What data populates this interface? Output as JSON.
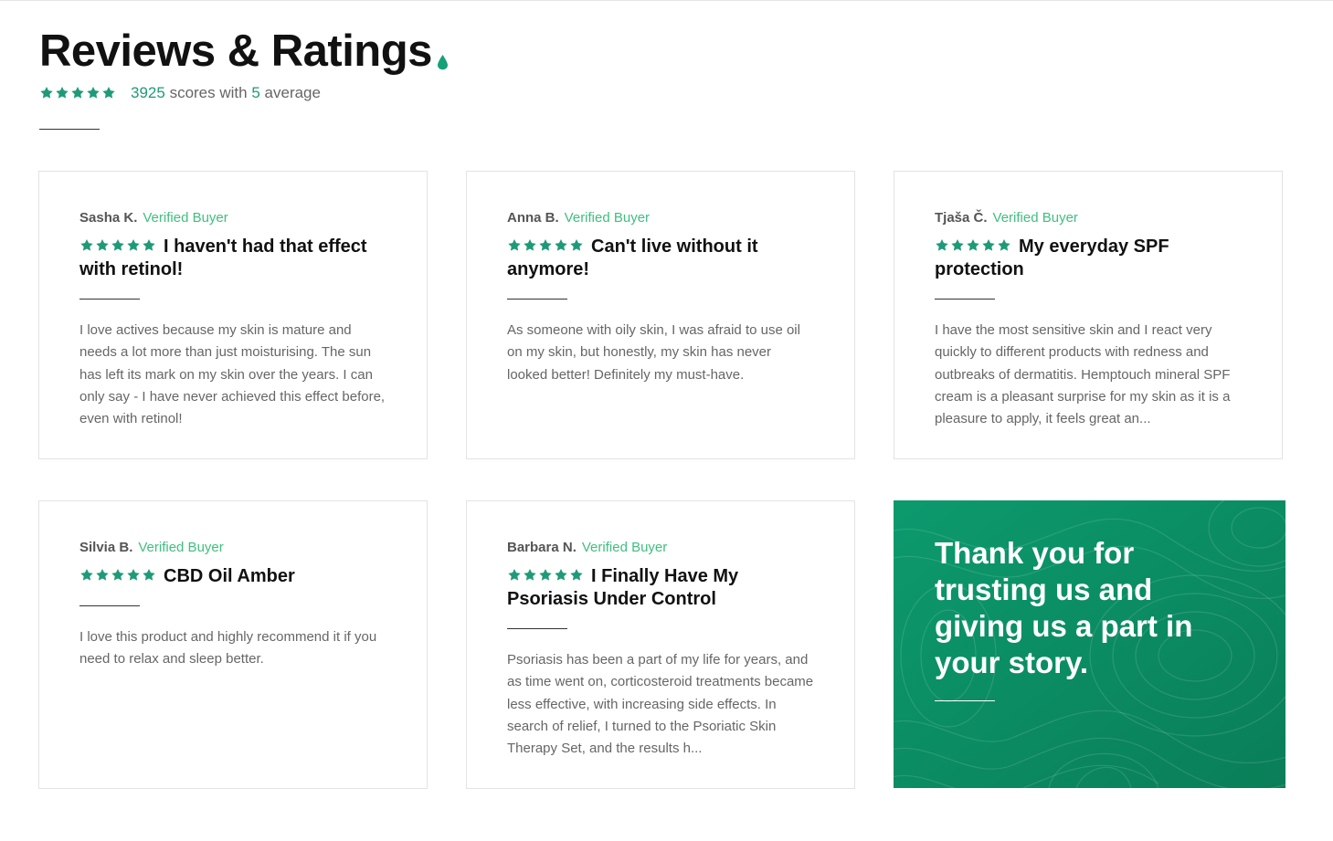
{
  "colors": {
    "accent": "#1f9a78",
    "verified": "#3fbf7f",
    "banner": "#0b8a62"
  },
  "header": {
    "title": "Reviews & Ratings",
    "rating": 5,
    "score_count": "3925",
    "scores_text": "scores with",
    "average_value": "5",
    "average_text": "average"
  },
  "reviews": [
    {
      "author": "Sasha K.",
      "badge": "Verified Buyer",
      "rating": 5,
      "headline": "I haven't had that effect with retinol!",
      "body": "I love actives because my skin is mature and needs a lot more than just moisturising. The sun has left its mark on my skin over the years. I can only say - I have never achieved this effect before, even with retinol!"
    },
    {
      "author": "Anna B.",
      "badge": "Verified Buyer",
      "rating": 5,
      "headline": "Can't live without it anymore!",
      "body": "As someone with oily skin, I was afraid to use oil on my skin, but honestly, my skin has never looked better! Definitely my must-have."
    },
    {
      "author": "Tjaša Č.",
      "badge": "Verified Buyer",
      "rating": 5,
      "headline": "My everyday SPF protection",
      "body": "I have the most sensitive skin and I react very quickly to different products with redness and outbreaks of dermatitis. Hemptouch mineral SPF cream is a pleasant surprise for my skin as it is a pleasure to apply, it feels great an..."
    },
    {
      "author": "Silvia B.",
      "badge": "Verified Buyer",
      "rating": 5,
      "headline": "CBD Oil Amber",
      "body": "I love this product and highly recommend it if you need to relax and sleep better."
    },
    {
      "author": "Barbara N.",
      "badge": "Verified Buyer",
      "rating": 5,
      "headline": "I Finally Have My Psoriasis Under Control",
      "body": "Psoriasis has been a part of my life for years, and as time went on, corticosteroid treatments became less effective, with increasing side effects. In search of relief, I turned to the Psoriatic Skin Therapy Set, and the results h..."
    }
  ],
  "banner": {
    "message": "Thank you for trusting us and giving us a part in your story."
  }
}
